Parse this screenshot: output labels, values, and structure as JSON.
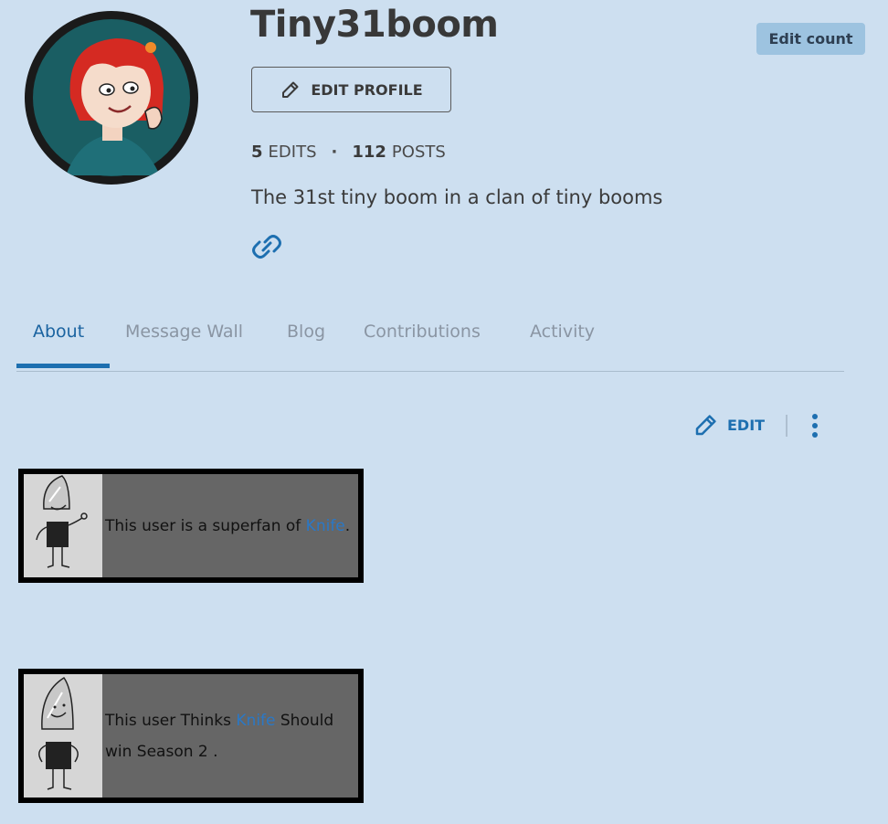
{
  "profile": {
    "username": "Tiny31boom",
    "edit_profile_label": "EDIT PROFILE",
    "edit_count_label": "Edit count",
    "edits_count": "5",
    "edits_label": "EDITS",
    "posts_count": "112",
    "posts_label": "POSTS",
    "bio": "The 31st tiny boom in a clan of tiny booms"
  },
  "tabs": [
    {
      "label": "About",
      "active": true
    },
    {
      "label": "Message Wall",
      "active": false
    },
    {
      "label": "Blog",
      "active": false
    },
    {
      "label": "Contributions",
      "active": false
    },
    {
      "label": "Activity",
      "active": false
    }
  ],
  "toolbar": {
    "edit_label": "EDIT"
  },
  "userboxes": [
    {
      "prefix": "This user is a superfan of ",
      "link": "Knife",
      "suffix": "."
    },
    {
      "prefix": "This user Thinks ",
      "link": "Knife",
      "suffix": " Should win Season 2 ."
    }
  ],
  "colors": {
    "background": "#cddff0",
    "accent": "#1d6fb0",
    "edit_count_bg": "#9dc3e0",
    "userbox_bg": "#666666",
    "link": "#2a78c6"
  },
  "icons": [
    "pencil-icon",
    "link-icon",
    "kebab-menu-icon",
    "avatar-image",
    "knife-character-image"
  ]
}
